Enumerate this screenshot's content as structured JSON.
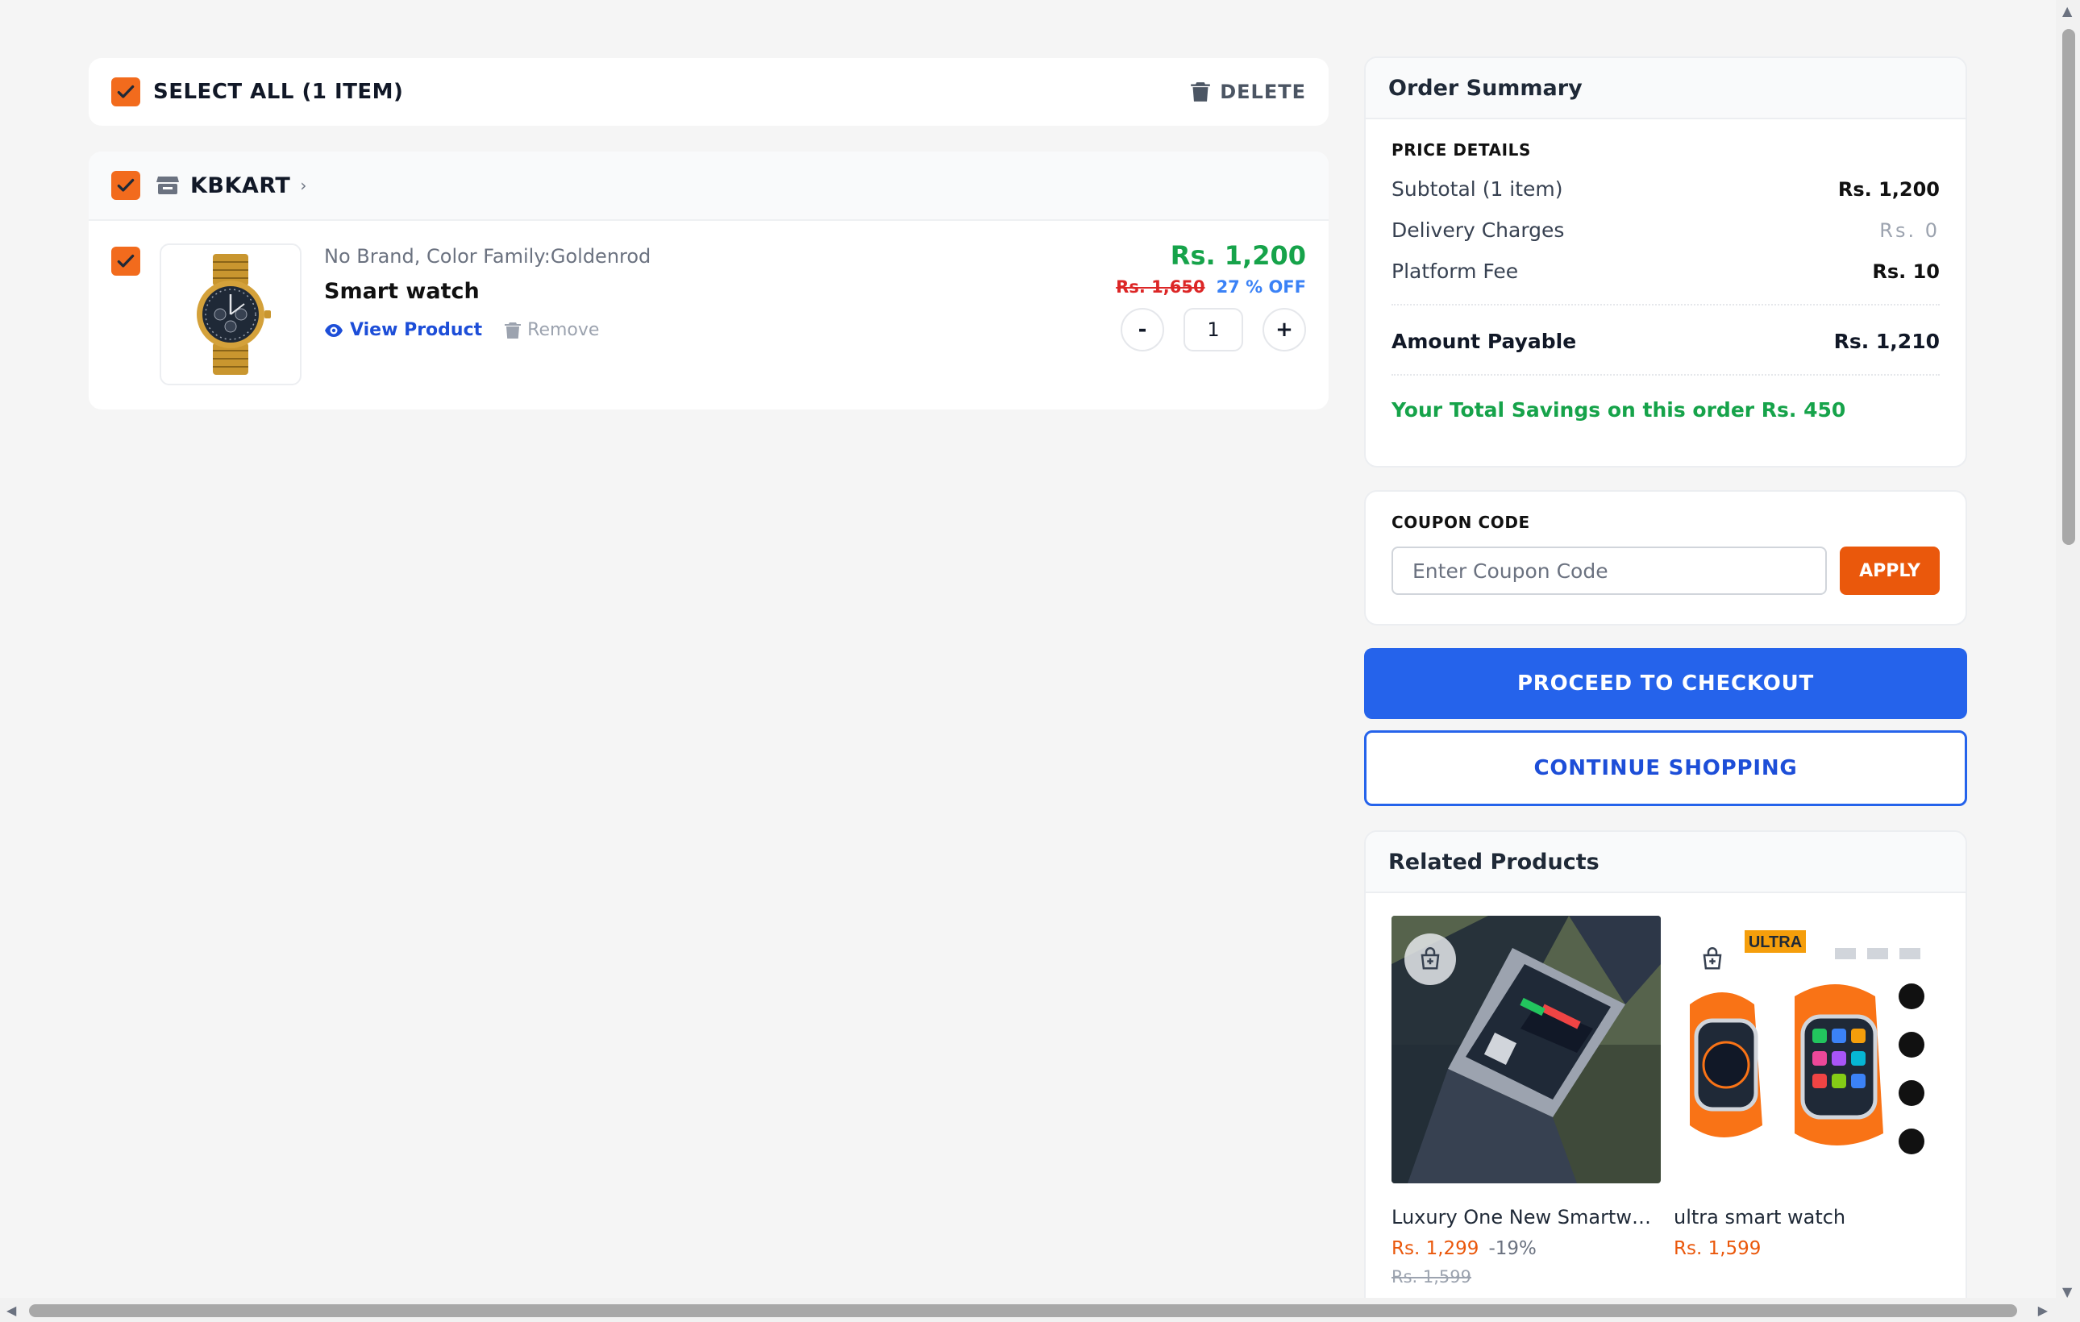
{
  "cart": {
    "select_all_label": "SELECT ALL (1 ITEM)",
    "delete_label": "DELETE",
    "store_name": "KBKART",
    "store_chevron": "›",
    "items": [
      {
        "variant": "No Brand, Color Family:Goldenrod",
        "name": "Smart watch",
        "view_label": "View Product",
        "remove_label": "Remove",
        "price": "Rs. 1,200",
        "original_price": "Rs. 1,650",
        "discount": "27 % OFF",
        "quantity": "1",
        "minus_label": "-",
        "plus_label": "+"
      }
    ]
  },
  "summary": {
    "title": "Order Summary",
    "section_label": "PRICE DETAILS",
    "subtotal_label": "Subtotal (1 item)",
    "subtotal_value": "Rs. 1,200",
    "delivery_label": "Delivery Charges",
    "delivery_value": "Rs. 0",
    "platform_label": "Platform Fee",
    "platform_value": "Rs. 10",
    "payable_label": "Amount Payable",
    "payable_value": "Rs. 1,210",
    "savings_text": "Your Total Savings on this order Rs. 450"
  },
  "coupon": {
    "label": "COUPON CODE",
    "placeholder": "Enter Coupon Code",
    "apply_label": "APPLY"
  },
  "actions": {
    "checkout_label": "PROCEED TO CHECKOUT",
    "continue_label": "CONTINUE SHOPPING"
  },
  "related": {
    "title": "Related Products",
    "products": [
      {
        "name": "Luxury One New Smartwatch",
        "price": "Rs. 1,299",
        "discount": "-19%",
        "original_price": "Rs. 1,599"
      },
      {
        "name": "ultra smart watch",
        "price": "Rs. 1,599",
        "badge": "ULTRA"
      }
    ]
  },
  "colors": {
    "accent_orange": "#f26b1d",
    "primary_blue": "#2563eb",
    "price_green": "#16a34a",
    "strike_red": "#dc2626"
  },
  "icons": [
    "check-icon",
    "trash-icon",
    "store-icon",
    "eye-icon",
    "cart-add-icon"
  ]
}
